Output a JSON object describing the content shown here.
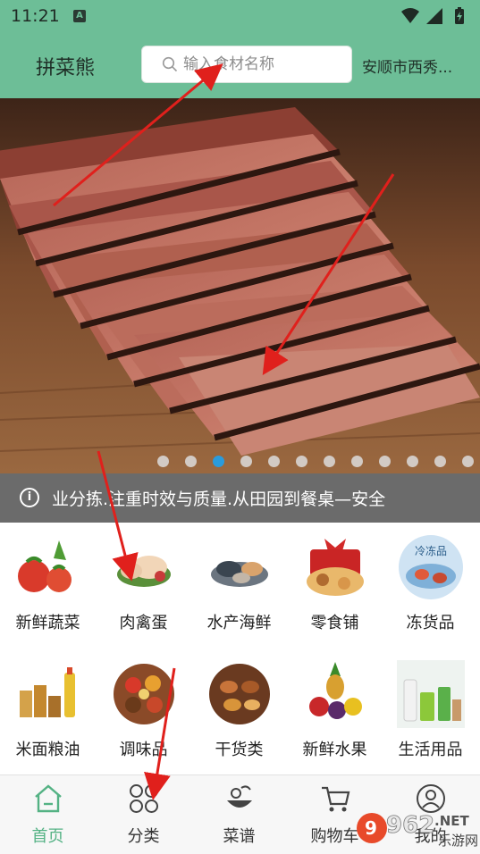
{
  "status_bar": {
    "time": "11:21",
    "notification_icon": "A"
  },
  "header": {
    "brand": "拼菜熊",
    "search_placeholder": "输入食材名称",
    "city": "安顺市西秀..."
  },
  "banner": {
    "dot_count": 12,
    "active_index": 2
  },
  "notice": {
    "text": "业分拣.注重时效与质量.从田园到餐桌—安全"
  },
  "categories": [
    {
      "label": "新鲜蔬菜",
      "icon": "vegetables-icon"
    },
    {
      "label": "肉禽蛋",
      "icon": "meat-poultry-icon"
    },
    {
      "label": "水产海鲜",
      "icon": "seafood-icon"
    },
    {
      "label": "零食铺",
      "icon": "snacks-icon"
    },
    {
      "label": "冻货品",
      "icon": "frozen-goods-icon",
      "badge": "冷冻品"
    },
    {
      "label": "米面粮油",
      "icon": "grain-oil-icon"
    },
    {
      "label": "调味品",
      "icon": "seasoning-icon"
    },
    {
      "label": "干货类",
      "icon": "dried-goods-icon"
    },
    {
      "label": "新鲜水果",
      "icon": "fruit-icon"
    },
    {
      "label": "生活用品",
      "icon": "daily-goods-icon"
    }
  ],
  "tabs": [
    {
      "label": "首页",
      "icon": "home-icon",
      "active": true
    },
    {
      "label": "分类",
      "icon": "category-icon",
      "active": false
    },
    {
      "label": "菜谱",
      "icon": "recipe-icon",
      "active": false
    },
    {
      "label": "购物车",
      "icon": "cart-icon",
      "active": false
    },
    {
      "label": "我的",
      "icon": "user-icon",
      "active": false
    }
  ],
  "watermark": {
    "number": "962",
    "suffix": ".NET",
    "site": "乐游网"
  },
  "colors": {
    "header": "#6dbe97",
    "active_tab": "#54b284",
    "active_dot": "#2a9bdc",
    "arrow": "#e0201c"
  }
}
